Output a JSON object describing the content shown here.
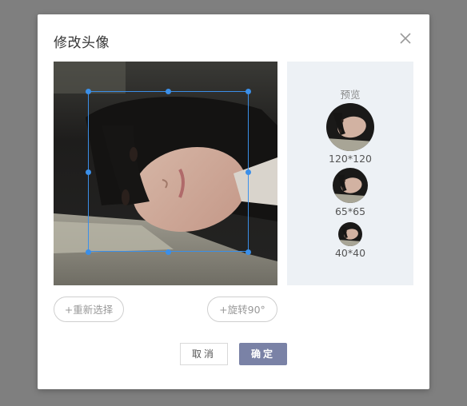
{
  "dialog": {
    "title": "修改头像",
    "close_icon": "close-icon"
  },
  "preview": {
    "label": "预览",
    "sizes": [
      "120*120",
      "65*65",
      "40*40"
    ]
  },
  "actions": {
    "reselect_label": "+重新选择",
    "rotate_label": "+旋转90°"
  },
  "footer": {
    "cancel_label": "取消",
    "ok_label": "确定"
  },
  "colors": {
    "accent": "#7a82a6",
    "crop_handle": "#3b8fe8",
    "preview_bg": "#edf1f5"
  }
}
